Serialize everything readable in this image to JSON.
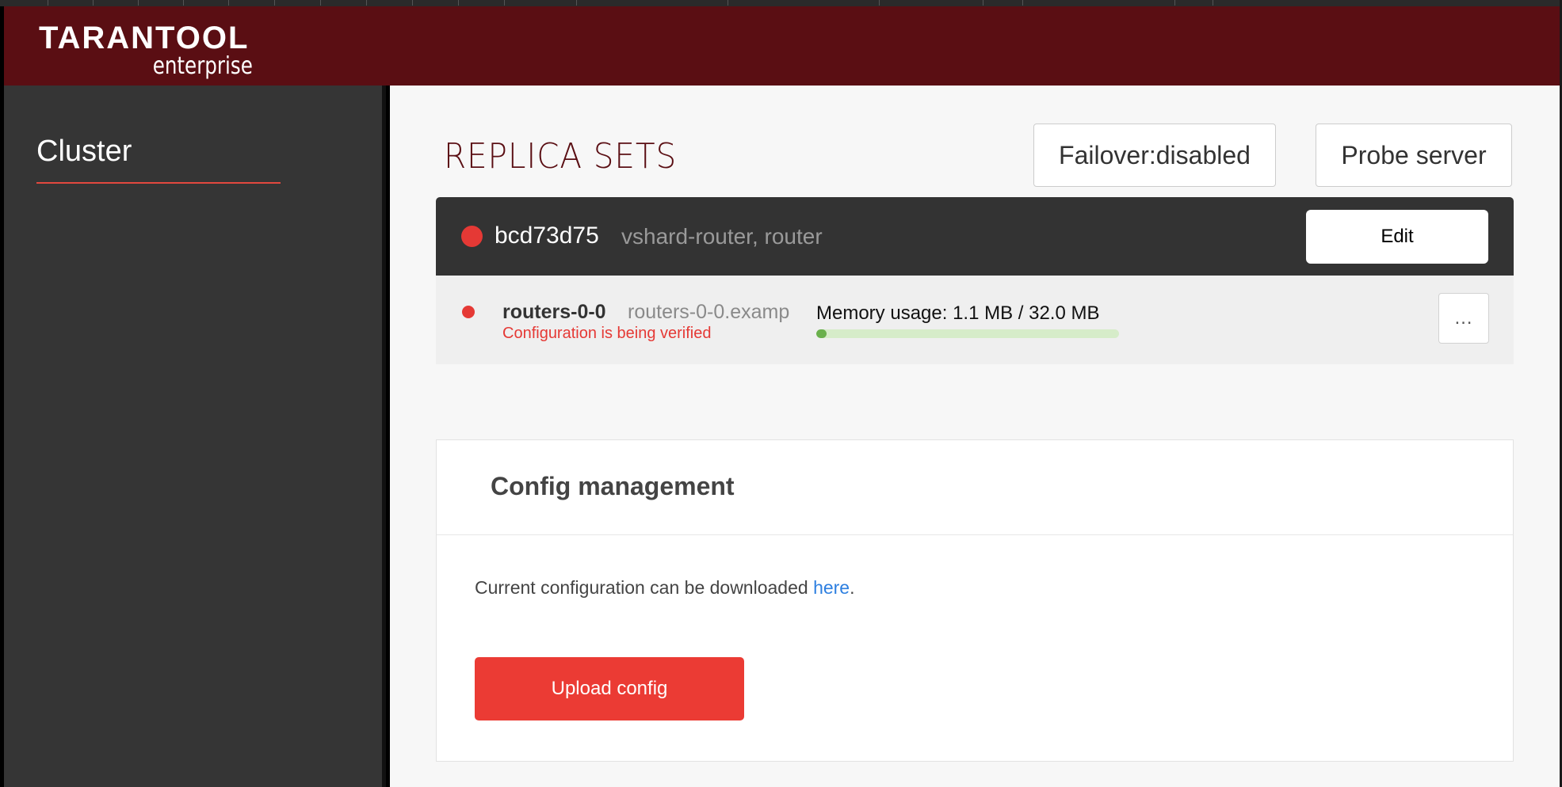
{
  "app": {
    "logo_main": "TARANTOOL",
    "logo_sub": "enterprise"
  },
  "sidebar": {
    "items": [
      {
        "label": "Cluster",
        "active": true
      }
    ]
  },
  "main": {
    "title": "REPLICA SETS",
    "failover_button": "Failover:disabled",
    "probe_button": "Probe server"
  },
  "replicaset": {
    "id": "bcd73d75",
    "roles": "vshard-router, router",
    "status_color": "#e53935",
    "edit_label": "Edit",
    "servers": [
      {
        "name": "routers-0-0",
        "uri": "routers-0-0.examp",
        "status": "Configuration is being verified",
        "memory_label": "Memory usage: 1.1 MB / 32.0 MB",
        "memory_used_fraction": 0.034,
        "more_icon": "…"
      }
    ]
  },
  "config": {
    "title": "Config management",
    "text_before_link": "Current configuration can be downloaded ",
    "link_text": "here",
    "text_after_link": ".",
    "upload_label": "Upload config"
  },
  "colors": {
    "header": "#5a0e13",
    "sidebar": "#353535",
    "accent_red": "#eb3b34",
    "link_blue": "#2d7fe0",
    "memory_fill": "#6ab04c"
  }
}
